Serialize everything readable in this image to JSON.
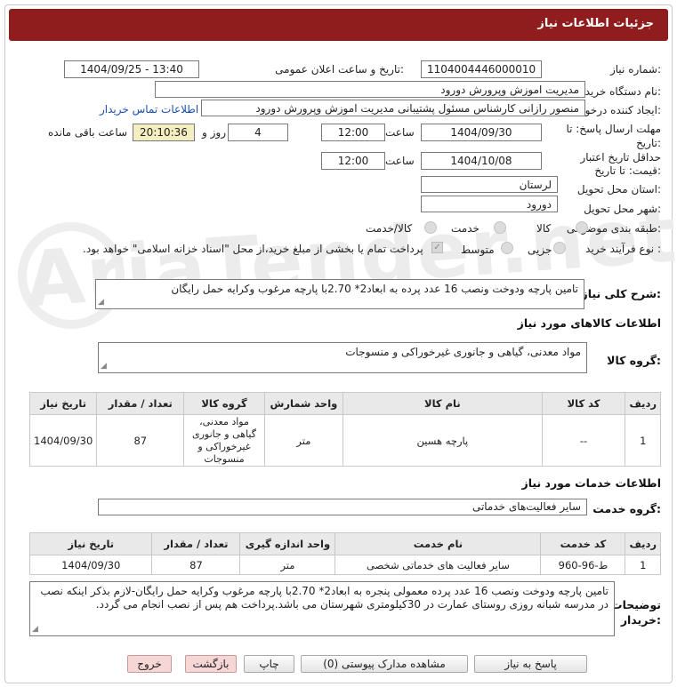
{
  "header": {
    "title": "جزئیات اطلاعات نیاز"
  },
  "watermark": {
    "text": "AriaTender.net"
  },
  "form": {
    "need_number_label": "شماره نیاز:",
    "need_number": "1104004446000010",
    "announce_label": "تاریخ و ساعت اعلان عمومی:",
    "announce_value": "1404/09/25 - 13:40",
    "buyer_org_label": "نام دستگاه خریدار:",
    "buyer_org": "مدیریت اموزش وپرورش دورود",
    "requester_label": "ایجاد کننده درخواست:",
    "requester": "منصور رازانی کارشناس مسئول پشتیبانی مدیریت اموزش وپرورش دورود",
    "contact_link": "اطلاعات تماس خریدار",
    "deadline_label_1": "مهلت ارسال پاسخ: تا",
    "deadline_label_2": "تاریخ:",
    "deadline_date": "1404/09/30",
    "time_word": "ساعت",
    "deadline_time": "12:00",
    "days_value": "4",
    "days_word": "روز و",
    "remaining_time": "20:10:36",
    "remaining_word": "ساعت باقی مانده",
    "validity_label_1": "حداقل تاریخ اعتبار",
    "validity_label_2": "قیمت: تا تاریخ:",
    "validity_date": "1404/10/08",
    "validity_time": "12:00",
    "province_label": "استان محل تحویل:",
    "province": "لرستان",
    "city_label": "شهر محل تحویل:",
    "city": "دورود",
    "category_label": "طبقه بندی موضوعی:",
    "category_options": [
      "کالا",
      "خدمت",
      "کالا/خدمت"
    ],
    "process_label": "نوع فرآیند خرید :",
    "process_options": [
      "جزیی",
      "متوسط"
    ],
    "treasury_note": "پرداخت تمام یا بخشی از مبلغ خرید،از محل \"اسناد خزانه اسلامی\" خواهد بود."
  },
  "summary": {
    "label": "شرح کلی نیاز:",
    "text": "تامین پارچه ودوخت ونصب 16 عدد پرده به ابعاد2* 2.70با پارچه مرغوب وکرایه حمل رایگان"
  },
  "goods": {
    "section_title": "اطلاعات کالاهای مورد نیاز",
    "group_label": "گروه کالا:",
    "group_value": "مواد معدنی، گیاهی و جانوری غیرخوراکی و منسوجات",
    "headers": [
      "ردیف",
      "کد کالا",
      "نام کالا",
      "واحد شمارش",
      "گروه کالا",
      "تعداد / مقدار",
      "تاریخ نیاز"
    ],
    "rows": [
      {
        "row": "1",
        "code": "--",
        "name": "پارچه هسین",
        "unit": "متر",
        "group": "مواد معدنی، گیاهی و جانوری غیرخوراکی و منسوجات",
        "qty": "87",
        "date": "1404/09/30"
      }
    ]
  },
  "services": {
    "section_title": "اطلاعات خدمات مورد نیاز",
    "group_label": "گروه خدمت:",
    "group_value": "سایر فعالیت‌های خدماتی",
    "headers": [
      "ردیف",
      "کد خدمت",
      "نام خدمت",
      "واحد اندازه گیری",
      "تعداد / مقدار",
      "تاریخ نیاز"
    ],
    "rows": [
      {
        "row": "1",
        "code": "ط-96-960",
        "name": "سایر فعالیت های خدماتی شخصی",
        "unit": "متر",
        "qty": "87",
        "date": "1404/09/30"
      }
    ]
  },
  "buyer_notes": {
    "label_1": "توضیحات",
    "label_2": "خریدار:",
    "text": "تامین پارچه ودوخت ونصب 16 عدد پرده معمولی پنجره به ابعاد2* 2.70با پارچه مرغوب وکرایه حمل رایگان-لازم بذکر اینکه نصب در مدرسه شبانه روزی روستای عمارت در 30کیلومتری شهرستان می باشد.پرداخت هم پس از نصب انجام می گردد."
  },
  "buttons": {
    "reply": "پاسخ به نیاز",
    "docs": "مشاهده مدارک پیوستی (0)",
    "print": "چاپ",
    "back": "بازگشت",
    "exit": "خروج"
  }
}
